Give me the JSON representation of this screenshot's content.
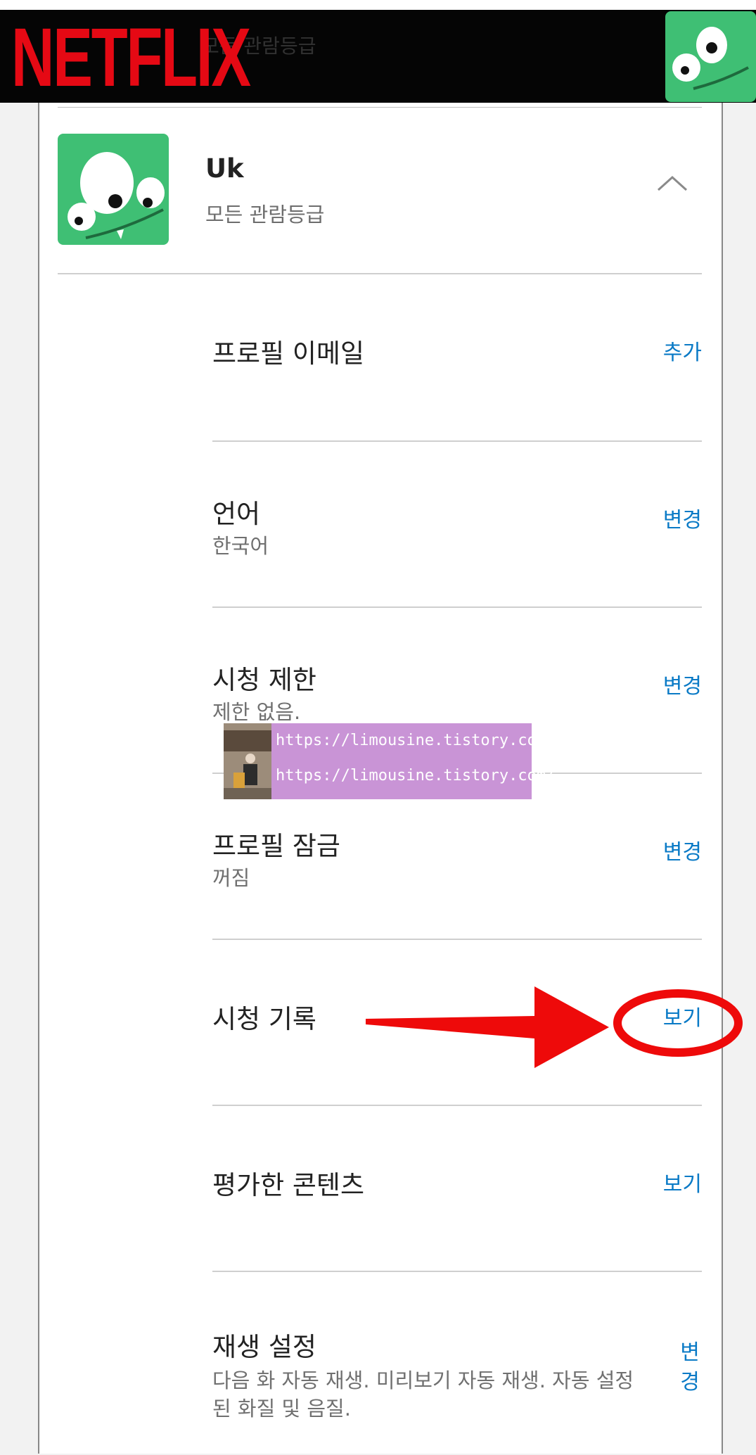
{
  "header": {
    "logo_text": "NETFLIX",
    "behind_text": "모든 관람등급",
    "brand_color": "#e50914"
  },
  "profile": {
    "name": "Uk",
    "rating": "모든 관람등급",
    "avatar_color": "#3fbf74",
    "toggle_icon": "chevron-up-icon"
  },
  "settings": [
    {
      "label": "프로필 이메일",
      "sub": "",
      "action": "추가"
    },
    {
      "label": "언어",
      "sub": "한국어",
      "action": "변경"
    },
    {
      "label": "시청 제한",
      "sub": "제한 없음.",
      "action": "변경"
    },
    {
      "label": "프로필 잠금",
      "sub": "꺼짐",
      "action": "변경"
    },
    {
      "label": "시청 기록",
      "sub": "",
      "action": "보기"
    },
    {
      "label": "평가한 콘텐츠",
      "sub": "",
      "action": "보기"
    },
    {
      "label": "재생 설정",
      "sub": "다음 화 자동 재생. 미리보기 자동 재생. 자동 설정된 화질 및 음질.",
      "action": "변경"
    }
  ],
  "watermark": {
    "line1": "https://limousine.tistory.com/",
    "line2": "https://limousine.tistory.com/"
  },
  "colors": {
    "link": "#0a7ac6",
    "annotation": "#ee0a0a"
  }
}
